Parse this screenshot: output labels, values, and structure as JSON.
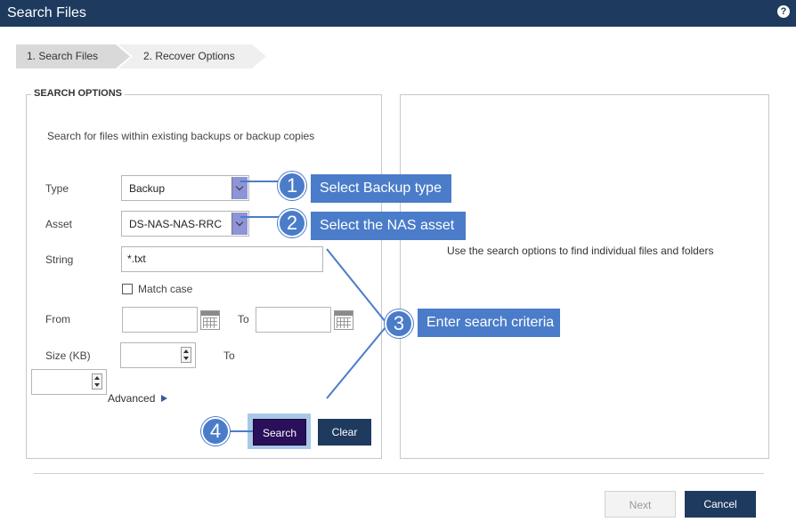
{
  "window": {
    "title": "Search Files",
    "help_icon": "question-circle-icon"
  },
  "wizard": {
    "steps": [
      "1. Search Files",
      "2. Recover Options"
    ],
    "active": 0
  },
  "search_options": {
    "legend": "SEARCH OPTIONS",
    "description": "Search for files within existing backups or backup copies",
    "type": {
      "label": "Type",
      "value": "Backup"
    },
    "asset": {
      "label": "Asset",
      "value": "DS-NAS-NAS-RRC"
    },
    "string": {
      "label": "String",
      "value": "*.txt"
    },
    "match_case": {
      "label": "Match case",
      "checked": false
    },
    "from": {
      "label": "From",
      "to_label": "To",
      "from_value": "",
      "to_value": ""
    },
    "size": {
      "label": "Size (KB)",
      "to_label": "To",
      "min_value": "",
      "max_value": ""
    },
    "advanced": {
      "label": "Advanced"
    },
    "search_button": "Search",
    "clear_button": "Clear"
  },
  "results": {
    "message": "Use the search options to find individual files and folders"
  },
  "footer": {
    "next": "Next",
    "cancel": "Cancel"
  },
  "callouts": [
    {
      "number": "1",
      "text": "Select Backup type"
    },
    {
      "number": "2",
      "text": "Select the NAS asset"
    },
    {
      "number": "3",
      "text": "Enter search criteria"
    },
    {
      "number": "4",
      "text": ""
    }
  ],
  "colors": {
    "header": "#1e3a5f",
    "callout": "#4a7cc9",
    "search_button": "#2a0f5a",
    "dropdown_arrow": "#8e94d8"
  }
}
